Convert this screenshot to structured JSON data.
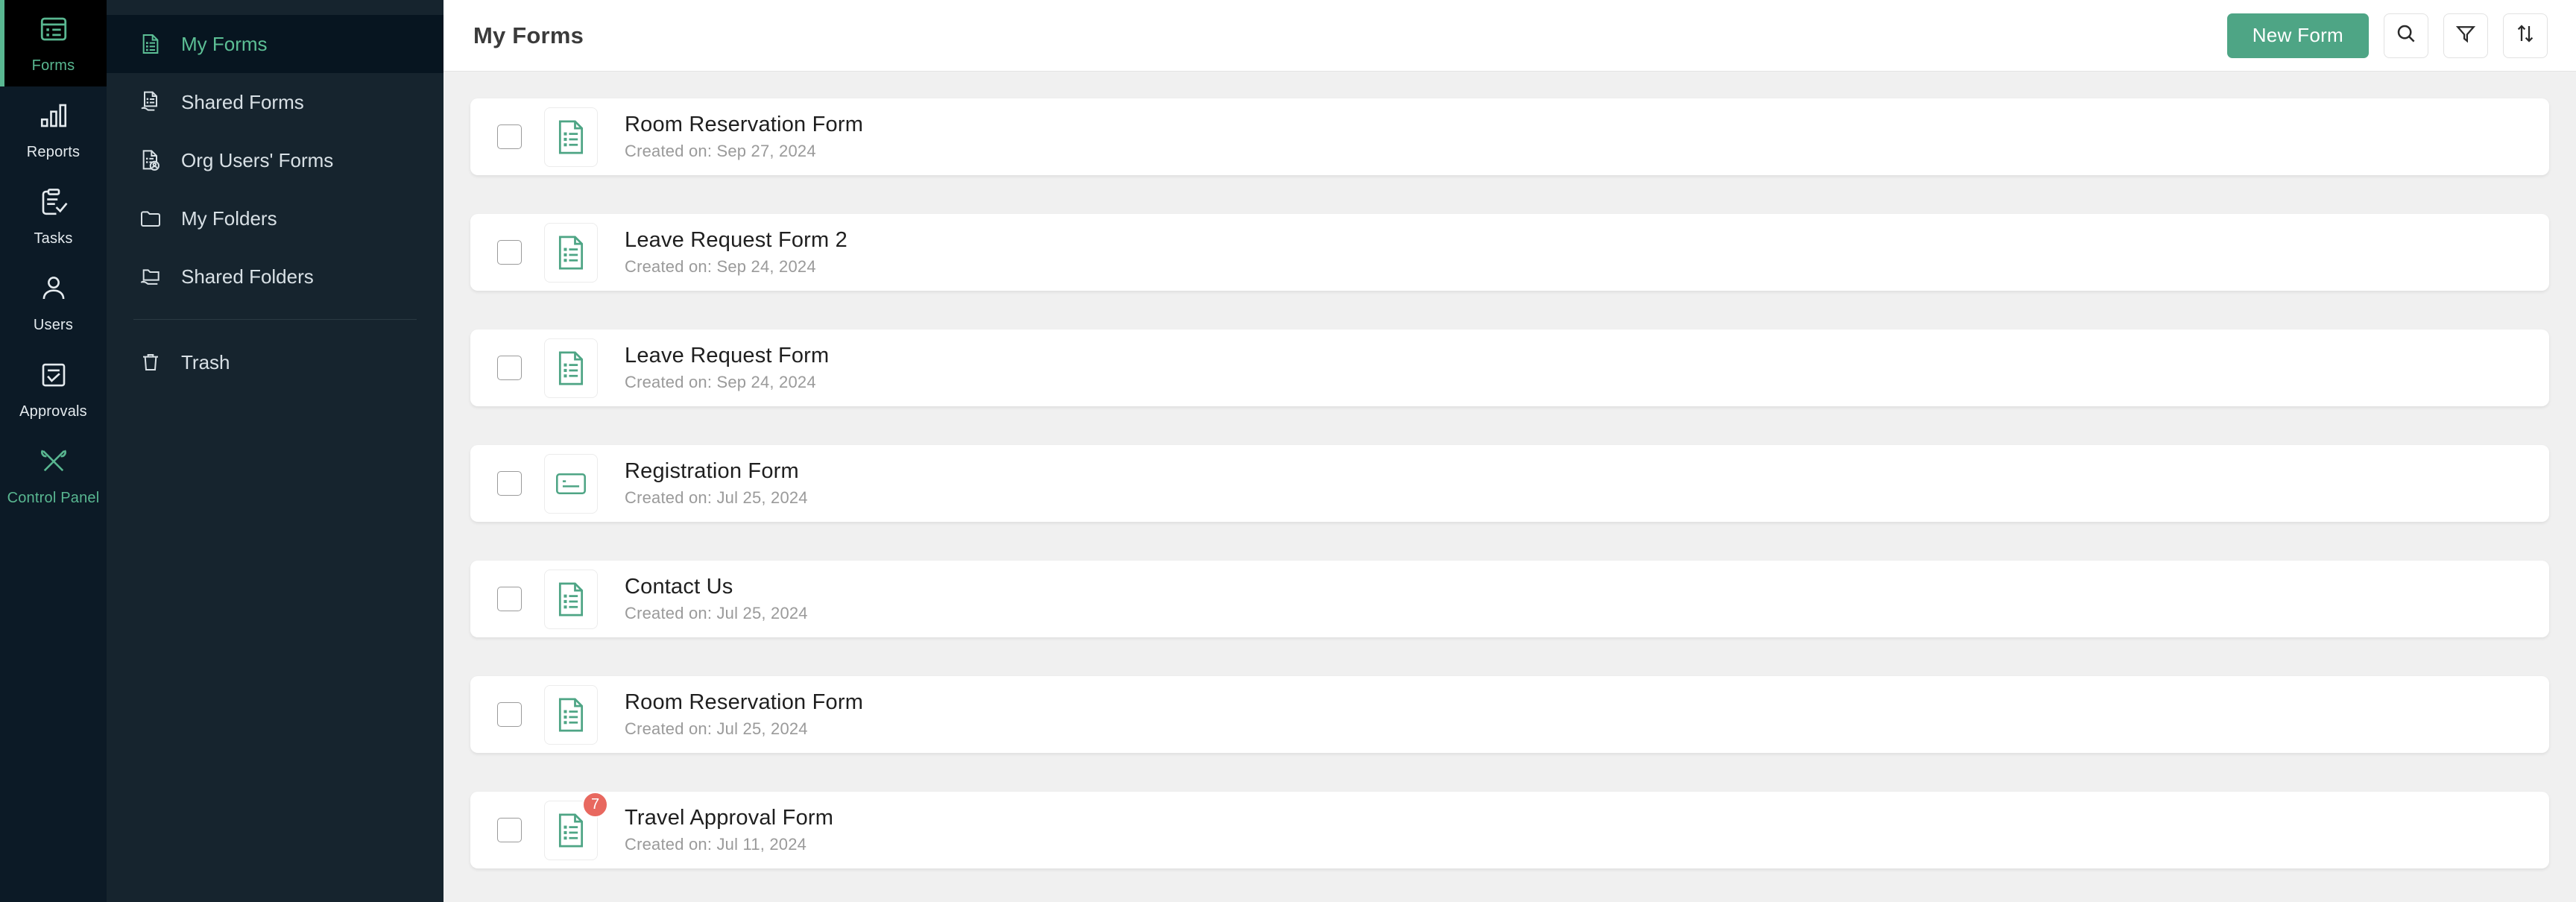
{
  "colors": {
    "accent_green": "#4ea585",
    "sidebar_dark": "#16242e",
    "rail_dark": "#0c1a26",
    "badge_red": "#e8685f",
    "page_bg": "#f0f0f0"
  },
  "rail": {
    "items": [
      {
        "label": "Forms",
        "icon": "forms-icon",
        "active": true
      },
      {
        "label": "Reports",
        "icon": "bar-chart-icon",
        "active": false
      },
      {
        "label": "Tasks",
        "icon": "clipboard-check-icon",
        "active": false
      },
      {
        "label": "Users",
        "icon": "user-icon",
        "active": false
      },
      {
        "label": "Approvals",
        "icon": "approval-check-icon",
        "active": false
      },
      {
        "label": "Control Panel",
        "icon": "tools-icon",
        "active": false
      }
    ]
  },
  "sidebar": {
    "items": [
      {
        "label": "My Forms",
        "icon": "document-list-icon",
        "active": true
      },
      {
        "label": "Shared Forms",
        "icon": "shared-document-icon",
        "active": false
      },
      {
        "label": "Org Users' Forms",
        "icon": "document-user-icon",
        "active": false
      },
      {
        "label": "My Folders",
        "icon": "folder-icon",
        "active": false
      },
      {
        "label": "Shared Folders",
        "icon": "shared-folder-icon",
        "active": false
      }
    ],
    "trash": {
      "label": "Trash",
      "icon": "trash-icon"
    }
  },
  "header": {
    "title": "My Forms",
    "new_form_label": "New Form",
    "search_icon": "search-icon",
    "filter_icon": "filter-icon",
    "sort_icon": "sort-icon"
  },
  "forms": [
    {
      "title": "Room Reservation Form",
      "subtitle": "Created on: Sep 27, 2024",
      "icon": "form-list-icon",
      "badge": null
    },
    {
      "title": "Leave Request Form 2",
      "subtitle": "Created on: Sep 24, 2024",
      "icon": "form-list-icon",
      "badge": null
    },
    {
      "title": "Leave Request Form",
      "subtitle": "Created on: Sep 24, 2024",
      "icon": "form-list-icon",
      "badge": null
    },
    {
      "title": "Registration Form",
      "subtitle": "Created on: Jul 25, 2024",
      "icon": "form-card-icon",
      "badge": null
    },
    {
      "title": "Contact Us",
      "subtitle": "Created on: Jul 25, 2024",
      "icon": "form-list-icon",
      "badge": null
    },
    {
      "title": "Room Reservation Form",
      "subtitle": "Created on: Jul 25, 2024",
      "icon": "form-list-icon",
      "badge": null
    },
    {
      "title": "Travel Approval Form",
      "subtitle": "Created on: Jul 11, 2024",
      "icon": "form-list-icon",
      "badge": "7"
    }
  ]
}
